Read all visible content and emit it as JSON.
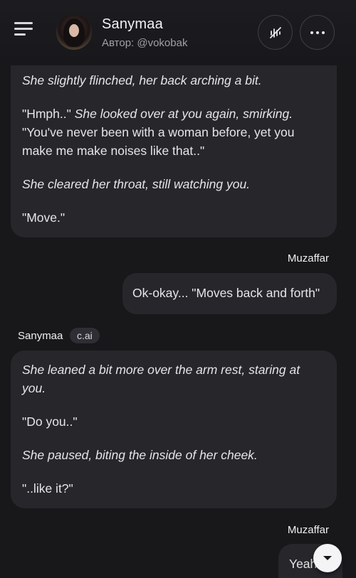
{
  "header": {
    "character_name": "Sanymaa",
    "author": "Автор: @vokobak",
    "icons": {
      "menu": "menu-icon",
      "voice": "voice-off-icon",
      "more": "more-icon"
    }
  },
  "messages": [
    {
      "lines": [
        "She slightly flinched, her back arching a bit.",
        "\"Hmph..\"",
        " She looked over at you again, smirking.",
        "\"You've never been with a woman before, yet you make me make noises like that..\"",
        "She cleared her throat, still watching you.",
        "\"Move.\""
      ]
    },
    {
      "sender": "Muzaffar",
      "text": "Ok-okay... \"Moves back and forth\""
    },
    {
      "sender": "Sanymaa",
      "tag": "c.ai",
      "lines": [
        "She leaned a bit more over the arm rest, staring at you.",
        "\"Do you..\"",
        "She paused, biting the inside of her cheek.",
        "\"..like it?\""
      ]
    },
    {
      "sender": "Muzaffar",
      "text": "Yeah"
    }
  ],
  "colors": {
    "background": "#18181b",
    "bubble": "#26262b",
    "text": "#e6e6e8"
  }
}
